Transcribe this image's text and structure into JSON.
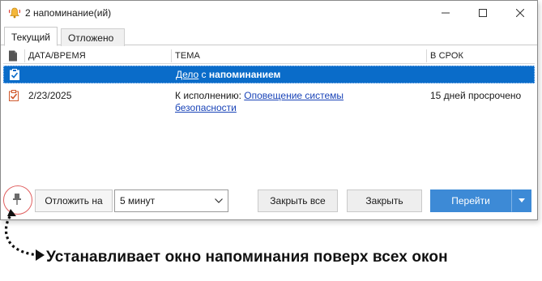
{
  "window": {
    "title": "2 напоминание(ий)"
  },
  "tabs": [
    {
      "label": "Текущий",
      "active": true
    },
    {
      "label": "Отложено",
      "active": false
    }
  ],
  "columns": {
    "datetime": "ДАТА/ВРЕМЯ",
    "subject": "ТЕМА",
    "due": "В СРОК"
  },
  "rows": [
    {
      "selected": true,
      "icon": "checklist-icon",
      "datetime": "",
      "subject_link": "Дело",
      "subject_mid": " с ",
      "subject_bold": "напоминанием",
      "due": ""
    },
    {
      "selected": false,
      "icon": "task-checklist-icon",
      "datetime": "2/23/2025",
      "subject_prefix": "К исполнению: ",
      "subject_link_1": "Оповещение системы",
      "subject_link_2": "безопасности",
      "due": "15 дней просрочено"
    }
  ],
  "toolbar": {
    "defer_label": "Отложить на",
    "defer_value": "5 минут",
    "dismiss_all": "Закрыть все",
    "dismiss": "Закрыть",
    "go": "Перейти"
  },
  "annotation": {
    "text": "Устанавливает окно напоминания поверх всех окон"
  },
  "colors": {
    "selected_row": "#0a6cc9",
    "link": "#1a44b8",
    "primary_button": "#3d8ad6",
    "highlight_circle": "#e06060"
  }
}
